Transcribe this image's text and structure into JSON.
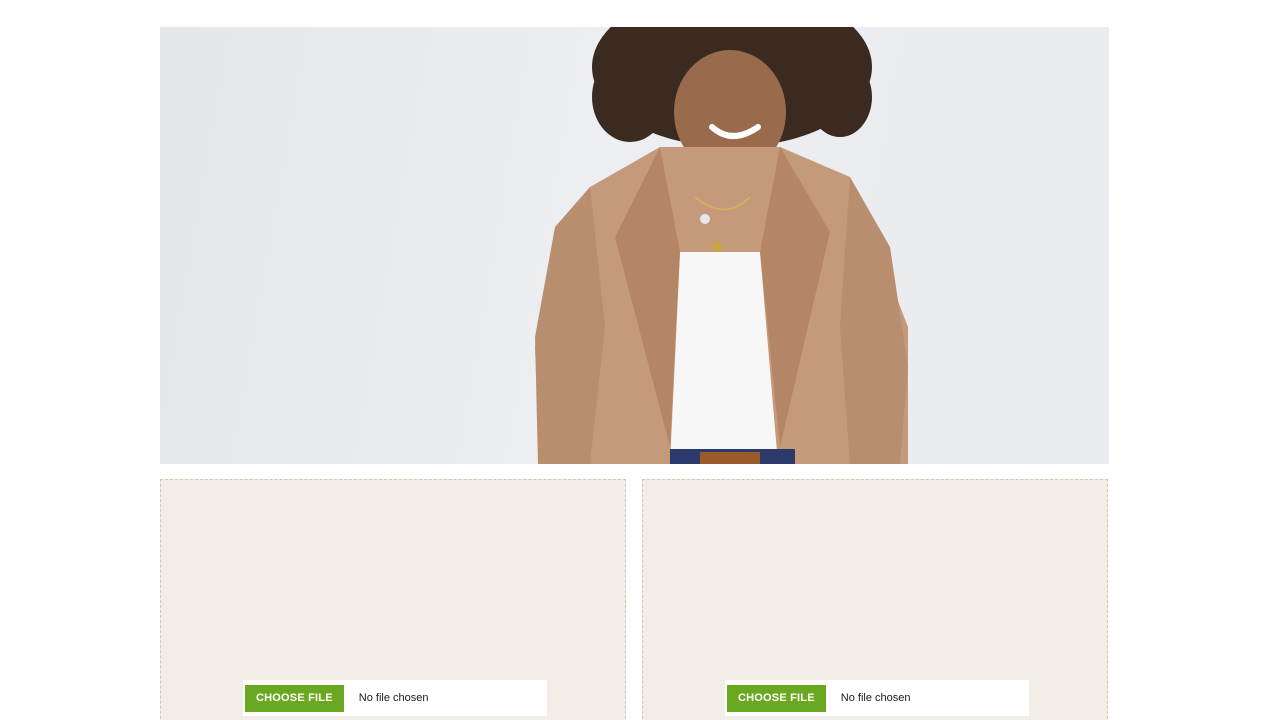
{
  "hero": {
    "image_description_icon": "woman-in-blazer-photo",
    "background_color": "#e8eaed"
  },
  "uploads": [
    {
      "button_label": "CHOOSE FILE",
      "status_text": "No file chosen"
    },
    {
      "button_label": "CHOOSE FILE",
      "status_text": "No file chosen"
    }
  ],
  "colors": {
    "button_green": "#6aa821",
    "panel_bg": "#f2ede7"
  }
}
